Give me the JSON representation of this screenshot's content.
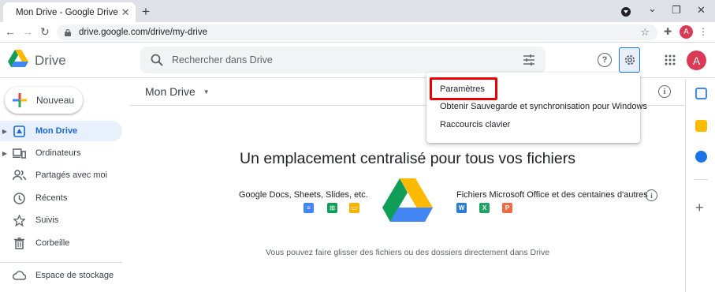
{
  "browser": {
    "tab_title": "Mon Drive - Google Drive",
    "tab_close": "✕",
    "new_tab": "+",
    "url": "drive.google.com/drive/my-drive",
    "back": "←",
    "forward": "→",
    "reload": "↻",
    "bookmark": "☆",
    "extensions": "✚",
    "profile_letter": "A",
    "menu": "⋮",
    "minimize": "⌄",
    "restore": "❐",
    "close": "✕"
  },
  "header": {
    "brand": "Drive",
    "search_placeholder": "Rechercher dans Drive",
    "help": "?",
    "avatar_letter": "A"
  },
  "settings_menu": {
    "items": [
      "Paramètres",
      "Obtenir Sauvegarde et synchronisation pour Windows",
      "Raccourcis clavier"
    ]
  },
  "sidebar": {
    "new_label": "Nouveau",
    "items": [
      {
        "label": "Mon Drive",
        "icon": "my-drive-icon",
        "active": true,
        "expandable": true
      },
      {
        "label": "Ordinateurs",
        "icon": "computers-icon",
        "active": false,
        "expandable": true
      },
      {
        "label": "Partagés avec moi",
        "icon": "shared-icon",
        "active": false,
        "expandable": false
      },
      {
        "label": "Récents",
        "icon": "clock-icon",
        "active": false,
        "expandable": false
      },
      {
        "label": "Suivis",
        "icon": "star-icon",
        "active": false,
        "expandable": false
      },
      {
        "label": "Corbeille",
        "icon": "trash-icon",
        "active": false,
        "expandable": false
      }
    ],
    "storage_label": "Espace de stockage"
  },
  "main": {
    "breadcrumb": "Mon Drive",
    "info": "i",
    "empty_title": "Un emplacement centralisé pour tous vos fichiers",
    "left_heading": "Google Docs, Sheets, Slides, etc.",
    "right_heading": "Fichiers Microsoft Office et des centaines d'autres",
    "office_letters": [
      "W",
      "X",
      "P"
    ],
    "drop_hint": "Vous pouvez faire glisser des fichiers ou des dossiers directement dans Drive"
  },
  "colors": {
    "accent": "#1a73e8",
    "active_bg": "#e8f0fe",
    "highlight_box": "#e60000",
    "avatar": "#d93a56"
  }
}
